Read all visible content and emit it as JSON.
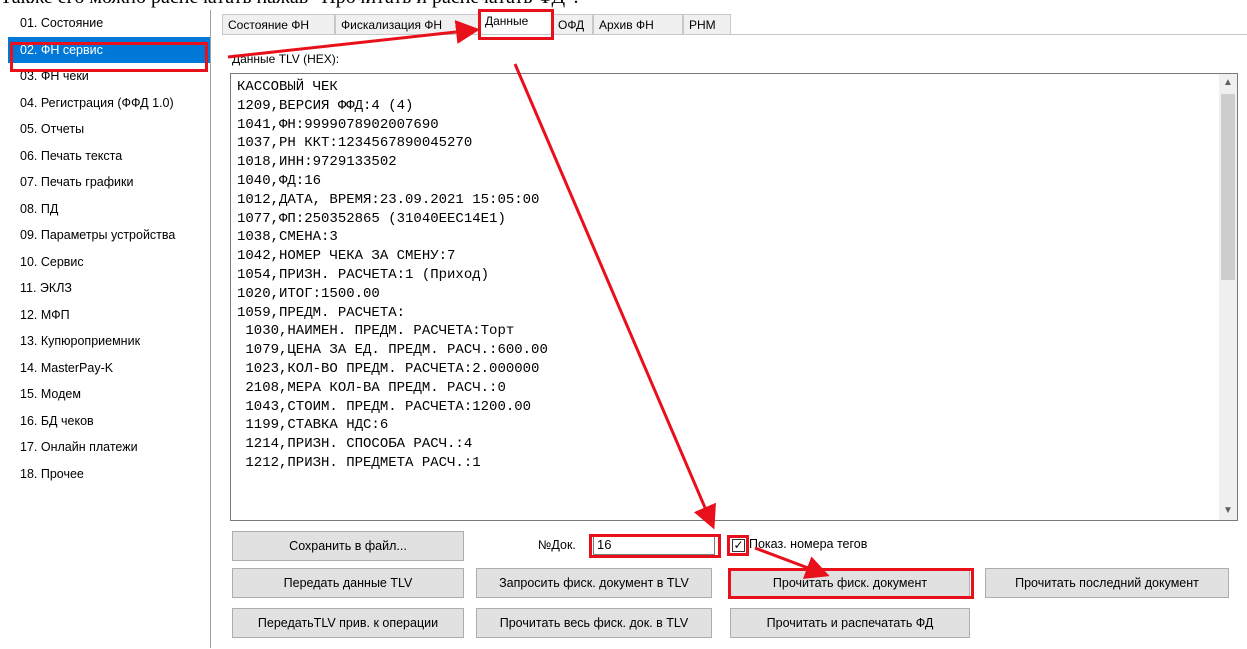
{
  "caption": "Также его можно распечатать нажав \"Прочитать и распечатать ФД\":",
  "sidebar": {
    "items": [
      {
        "label": "01. Состояние"
      },
      {
        "label": "02. ФН сервис"
      },
      {
        "label": "03. ФН чеки"
      },
      {
        "label": "04. Регистрация (ФФД 1.0)"
      },
      {
        "label": "05. Отчеты"
      },
      {
        "label": "06. Печать текста"
      },
      {
        "label": "07. Печать графики"
      },
      {
        "label": "08. ПД"
      },
      {
        "label": "09. Параметры устройства"
      },
      {
        "label": "10. Сервис"
      },
      {
        "label": "11. ЭКЛЗ"
      },
      {
        "label": "12. МФП"
      },
      {
        "label": "13. Купюроприемник"
      },
      {
        "label": "14. MasterPay-K"
      },
      {
        "label": "15. Модем"
      },
      {
        "label": "16. БД чеков"
      },
      {
        "label": "17. Онлайн платежи"
      },
      {
        "label": "18. Прочее"
      }
    ],
    "selected_index": 1
  },
  "tabs": [
    {
      "label": "Состояние ФН"
    },
    {
      "label": "Фискализация ФН"
    },
    {
      "label": "Данные"
    },
    {
      "label": "ОФД"
    },
    {
      "label": "Архив ФН"
    },
    {
      "label": "РНМ"
    }
  ],
  "active_tab": "Данные",
  "tlv": {
    "label": "Данные TLV (HEX):",
    "content": "КАССОВЫЙ ЧЕК\n1209,ВЕРСИЯ ФФД:4 (4)\n1041,ФН:9999078902007690\n1037,РН ККТ:1234567890045270\n1018,ИНН:9729133502\n1040,ФД:16\n1012,ДАТА, ВРЕМЯ:23.09.2021 15:05:00\n1077,ФП:250352865 (31040EEC14E1)\n1038,СМЕНА:3\n1042,НОМЕР ЧЕКА ЗА СМЕНУ:7\n1054,ПРИЗН. РАСЧЕТА:1 (Приход)\n1020,ИТОГ:1500.00\n1059,ПРЕДМ. РАСЧЕТА:\n 1030,НАИМЕН. ПРЕДМ. РАСЧЕТА:Торт\n 1079,ЦЕНА ЗА ЕД. ПРЕДМ. РАСЧ.:600.00\n 1023,КОЛ-ВО ПРЕДМ. РАСЧЕТА:2.000000\n 2108,МЕРА КОЛ-ВА ПРЕДМ. РАСЧ.:0\n 1043,СТОИМ. ПРЕДМ. РАСЧЕТА:1200.00\n 1199,СТАВКА НДС:6\n 1214,ПРИЗН. СПОСОБА РАСЧ.:4\n 1212,ПРИЗН. ПРЕДМЕТА РАСЧ.:1"
  },
  "controls": {
    "doc_label": "№Док.",
    "doc_value": "16",
    "show_tags_label": "Показ. номера тегов",
    "show_tags_checked": true
  },
  "buttons": {
    "save": "Сохранить в файл...",
    "send_tlv": "Передать данные TLV",
    "request_fisc_tlv": "Запросить фиск. документ в TLV",
    "read_fisc": "Прочитать фиск. документ",
    "read_last": "Прочитать последний документ",
    "send_tlv_op": "ПередатьTLV прив. к операции",
    "read_whole_tlv": "Прочитать весь фиск. док. в TLV",
    "read_print": "Прочитать и распечатать ФД"
  },
  "icons": {
    "scroll_up": "chevron-up-icon",
    "scroll_down": "chevron-down-icon",
    "check": "check-icon"
  },
  "colors": {
    "highlight": "#e8101a",
    "selection": "#0078d7"
  }
}
